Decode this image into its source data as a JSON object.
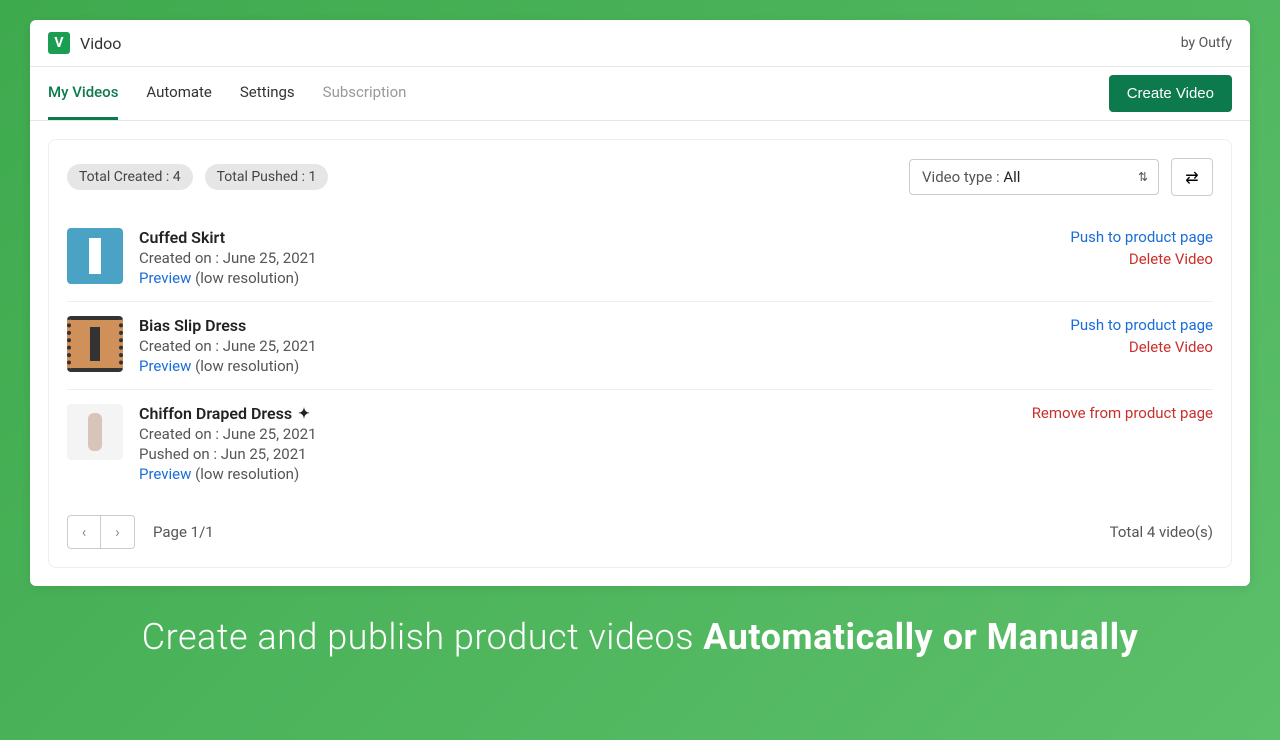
{
  "header": {
    "brand_initial": "V",
    "brand_name": "Vidoo",
    "byline": "by Outfy"
  },
  "nav": {
    "tabs": [
      "My Videos",
      "Automate",
      "Settings",
      "Subscription"
    ],
    "active_index": 0,
    "muted_index": 3,
    "create_label": "Create Video"
  },
  "stats": {
    "created": "Total Created : 4",
    "pushed": "Total Pushed : 1"
  },
  "filter": {
    "label": "Video type : ",
    "value": "All"
  },
  "videos": [
    {
      "title": "Cuffed Skirt",
      "created": "Created on : June 25, 2021",
      "pushed": "",
      "preview": "Preview",
      "lowres": " (low resolution)",
      "actions": [
        {
          "text": "Push to product page",
          "cls": "link-blue"
        },
        {
          "text": "Delete Video",
          "cls": "link-red"
        }
      ],
      "indicator": ""
    },
    {
      "title": "Bias Slip Dress",
      "created": "Created on : June 25, 2021",
      "pushed": "",
      "preview": "Preview",
      "lowres": " (low resolution)",
      "actions": [
        {
          "text": "Push to product page",
          "cls": "link-blue"
        },
        {
          "text": "Delete Video",
          "cls": "link-red"
        }
      ],
      "indicator": ""
    },
    {
      "title": "Chiffon Draped Dress",
      "created": "Created on : June 25, 2021",
      "pushed": "Pushed on : Jun 25, 2021",
      "preview": "Preview",
      "lowres": " (low resolution)",
      "actions": [
        {
          "text": "Remove from product page",
          "cls": "link-red"
        }
      ],
      "indicator": "✦"
    }
  ],
  "pagination": {
    "page_label": "Page 1/1",
    "total_label": "Total 4 video(s)"
  },
  "banner": {
    "prefix": "Create and publish product videos ",
    "strong": "Automatically or Manually"
  }
}
